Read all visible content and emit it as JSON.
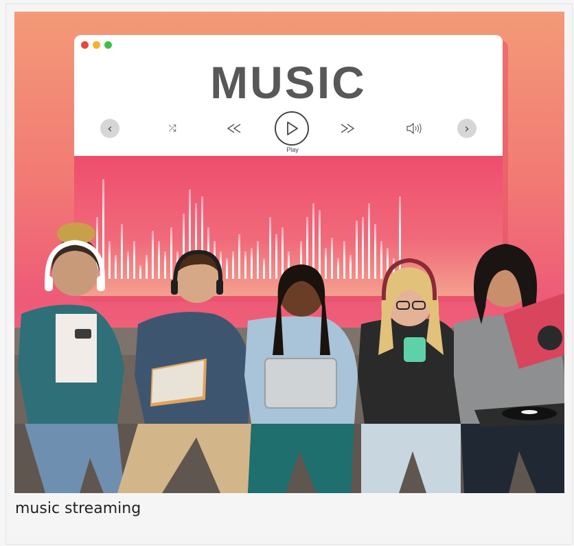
{
  "image": {
    "window_title": "MUSIC",
    "controls": {
      "prev_icon": "chevron-left-icon",
      "shuffle_icon": "shuffle-icon",
      "rewind_icon": "rewind-icon",
      "play_icon": "play-icon",
      "play_label": "Play",
      "fast_forward_icon": "fast-forward-icon",
      "volume_icon": "volume-icon",
      "next_icon": "chevron-right-icon"
    },
    "traffic_lights": [
      "#e9473d",
      "#f4b22a",
      "#3fbf4a"
    ]
  },
  "caption": "music streaming"
}
